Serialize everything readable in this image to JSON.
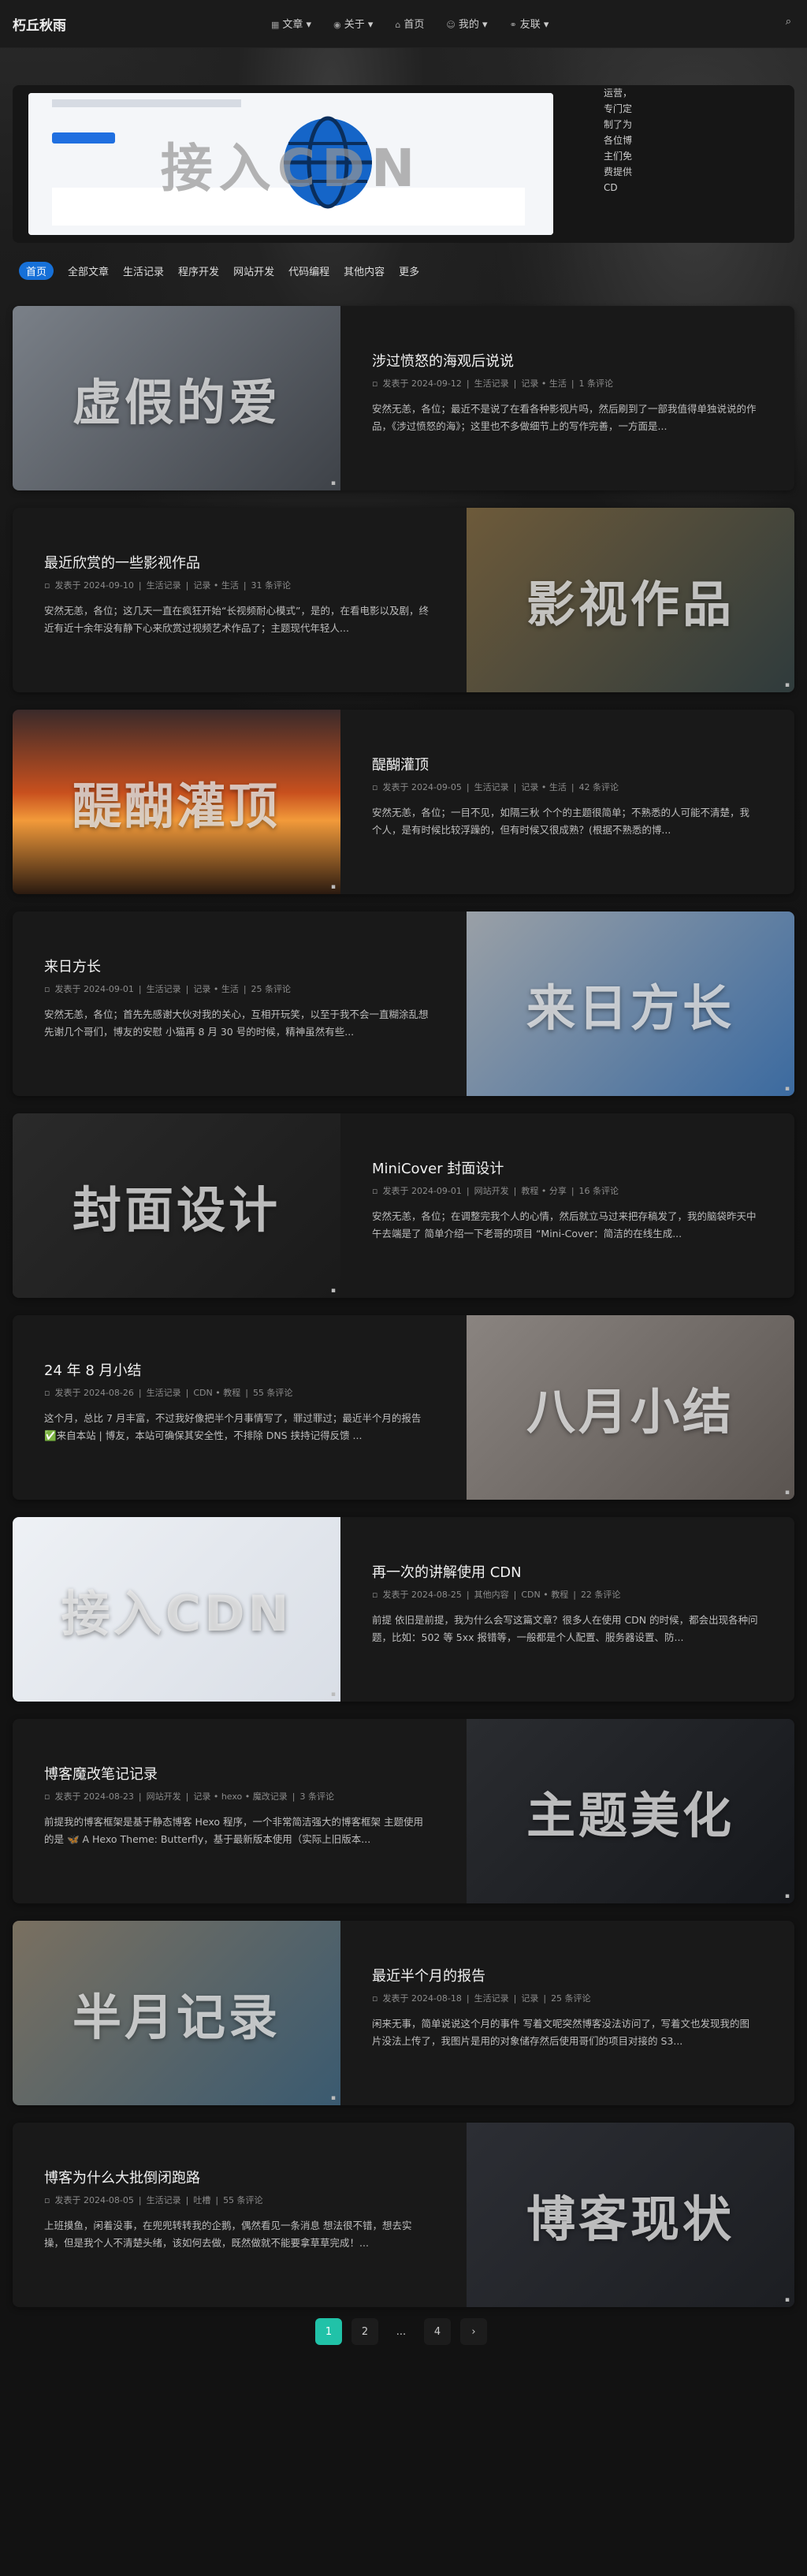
{
  "site": {
    "title": "朽丘秋雨"
  },
  "nav": {
    "items": [
      {
        "label": "文章",
        "icon": "grid-icon"
      },
      {
        "label": "关于",
        "icon": "user-icon"
      },
      {
        "label": "首页",
        "icon": "home-icon"
      },
      {
        "label": "我的",
        "icon": "person-icon"
      },
      {
        "label": "友联",
        "icon": "link-icon"
      }
    ]
  },
  "hero": {
    "cover_label": "接入CDN",
    "description": "运营，专门定制了为各位博主们免费提供CD"
  },
  "tabs": [
    "首页",
    "全部文章",
    "生活记录",
    "程序开发",
    "网站开发",
    "代码编程",
    "其他内容",
    "更多"
  ],
  "posts": [
    {
      "title": "涉过愤怒的海观后说说",
      "date": "发表于 2024-09-12",
      "category": "生活记录",
      "tags": "记录 • 生活",
      "comments": "1 条评论",
      "excerpt": "安然无恙，各位；最近不是说了在看各种影视片吗，然后刷到了一部我值得单独说说的作品，《涉过愤怒的海》；这里也不多做细节上的写作完善，一方面是...",
      "cover": "虚假的爱",
      "cover_side": "left"
    },
    {
      "title": "最近欣赏的一些影视作品",
      "date": "发表于 2024-09-10",
      "category": "生活记录",
      "tags": "记录 • 生活",
      "comments": "31 条评论",
      "excerpt": "安然无恙，各位；这几天一直在疯狂开始“长视频耐心模式”，是的，在看电影以及剧，终近有近十余年没有静下心来欣赏过视频艺术作品了；主题现代年轻人...",
      "cover": "影视作品",
      "cover_side": "right"
    },
    {
      "title": "醍醐灌顶",
      "date": "发表于 2024-09-05",
      "category": "生活记录",
      "tags": "记录 • 生活",
      "comments": "42 条评论",
      "excerpt": "安然无恙，各位；一目不见，如隔三秋 个个的主题很简单；不熟悉的人可能不清楚，我个人，是有时候比较浮躁的，但有时候又很成熟？(根据不熟悉的博...",
      "cover": "醍醐灌顶",
      "cover_side": "left"
    },
    {
      "title": "来日方长",
      "date": "发表于 2024-09-01",
      "category": "生活记录",
      "tags": "记录 • 生活",
      "comments": "25 条评论",
      "excerpt": "安然无恙，各位；首先先感谢大伙对我的关心，互相开玩笑，以至于我不会一直糊涂乱想 先谢几个哥们，博友的安慰 小猫再 8 月 30 号的时候，精神虽然有些...",
      "cover": "来日方长",
      "cover_side": "right"
    },
    {
      "title": "MiniCover 封面设计",
      "date": "发表于 2024-09-01",
      "category": "网站开发",
      "tags": "教程 • 分享",
      "comments": "16 条评论",
      "excerpt": "安然无恙，各位；在调整完我个人的心情，然后就立马过来把存稿发了，我的脑袋昨天中午去端是了 简单介绍一下老哥的项目 “Mini-Cover：简洁的在线生成...",
      "cover": "封面设计",
      "cover_side": "left"
    },
    {
      "title": "24 年 8 月小结",
      "date": "发表于 2024-08-26",
      "category": "生活记录",
      "tags": "CDN • 教程",
      "comments": "55 条评论",
      "excerpt": "这个月，总比 7 月丰富，不过我好像把半个月事情写了，罪过罪过；最近半个月的报告 ✅来自本站 | 博友，本站可确保其安全性，不排除 DNS 挟持记得反馈 ...",
      "cover": "八月小结",
      "cover_side": "right"
    },
    {
      "title": "再一次的讲解使用 CDN",
      "date": "发表于 2024-08-25",
      "category": "其他内容",
      "tags": "CDN • 教程",
      "comments": "22 条评论",
      "excerpt": "前提 依旧是前提，我为什么会写这篇文章？很多人在使用 CDN 的时候，都会出现各种问题，比如：502 等 5xx 报错等，一般都是个人配置、服务器设置、防...",
      "cover": "接入CDN",
      "cover_side": "left"
    },
    {
      "title": "博客魔改笔记记录",
      "date": "发表于 2024-08-23",
      "category": "网站开发",
      "tags": "记录 • hexo • 魔改记录",
      "comments": "3 条评论",
      "excerpt": "前提我的博客框架是基于静态博客 Hexo 程序，一个非常简洁强大的博客框架 主题使用的是 🦋 A Hexo Theme: Butterfly，基于最新版本使用（实际上旧版本...",
      "cover": "主题美化",
      "cover_side": "right"
    },
    {
      "title": "最近半个月的报告",
      "date": "发表于 2024-08-18",
      "category": "生活记录",
      "tags": "记录",
      "comments": "25 条评论",
      "excerpt": "闲来无事，简单说说这个月的事件 写着文呢突然博客没法访问了，写着文也发现我的图片没法上传了，我图片是用的对象储存然后使用哥们的项目对接的 S3...",
      "cover": "半月记录",
      "cover_side": "left"
    },
    {
      "title": "博客为什么大批倒闭跑路",
      "date": "发表于 2024-08-05",
      "category": "生活记录",
      "tags": "吐槽",
      "comments": "55 条评论",
      "excerpt": "上班摸鱼，闲着没事，在兜兜转转我的企鹅，偶然看见一条消息 想法很不错，想去实操，但是我个人不清楚头绪，该如何去做，既然做就不能要拿草草完成！...",
      "cover": "博客现状",
      "cover_side": "right"
    }
  ],
  "pager": {
    "pages": [
      "1",
      "2",
      "...",
      "4"
    ],
    "next_icon": "chevron-right-icon"
  }
}
